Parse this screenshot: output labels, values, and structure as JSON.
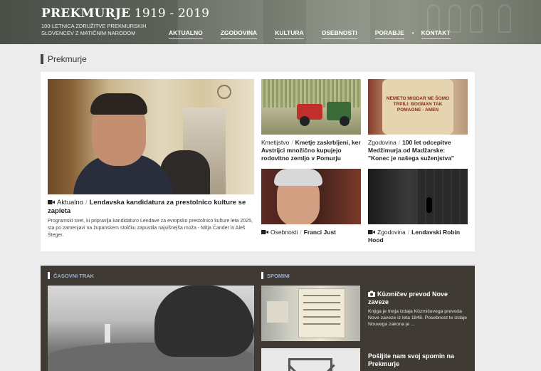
{
  "header": {
    "title_bold": "PREKMURJE",
    "title_years": "1919 - 2019",
    "subtitle": "100-LETNICA ZDRUŽITVE PREKMURSKIH SLOVENCEV Z MATIČNIM NARODOM",
    "nav": [
      "AKTUALNO",
      "ZGODOVINA",
      "KULTURA",
      "OSEBNOSTI",
      "PORABJE",
      "KONTAKT"
    ]
  },
  "section": {
    "title": "Prekmurje"
  },
  "featured": {
    "category": "Aktualno",
    "title": "Lendavska kandidatura za prestolnico kulture se zapleta",
    "description": "Programski svet, ki pripravlja kandidaturo Lendave za evropsko prestolnico kulture leta 2025, sta po zamenjavi na županskem stolčku zapustila najvišnejša moža - Mitja Čander in Aleš Šteger."
  },
  "articles": [
    {
      "category": "Kmetijstvo",
      "title": "Kmetje zaskrbljeni, ker Avstrijci množično kupujejo rodovitno zemljo v Pomurju",
      "video": false
    },
    {
      "category": "Zgodovina",
      "title": "100 let odcepitve Medžimurja od Madžarske: \"Konec je našega suženjstva\"",
      "video": false
    },
    {
      "category": "Osebnosti",
      "title": "Franci Just",
      "video": true
    },
    {
      "category": "Zgodovina",
      "title": "Lendavski Robin Hood",
      "video": true
    }
  ],
  "jar_label": "NEMETO MIGDAR NE ŠOMO TRPILI: BOGMAN TAK POMAGNE - AMEN",
  "timeline": {
    "label": "ČASOVNI TRAK"
  },
  "memories": {
    "label": "SPOMINI",
    "item_title": "Küzmičev prevod Nove zaveze",
    "item_text": "Knjiga je tretja izdaja Küzmičevega prevoda Nove zaveze iz leta 1848. Posebnost te izdaje Nouvega zakona je ...",
    "send_title": "Pošljite nam svoj spomin na Prekmurje"
  },
  "colors": {
    "accent_label": "#8fb0d6",
    "dark_bg": "#403a35"
  }
}
